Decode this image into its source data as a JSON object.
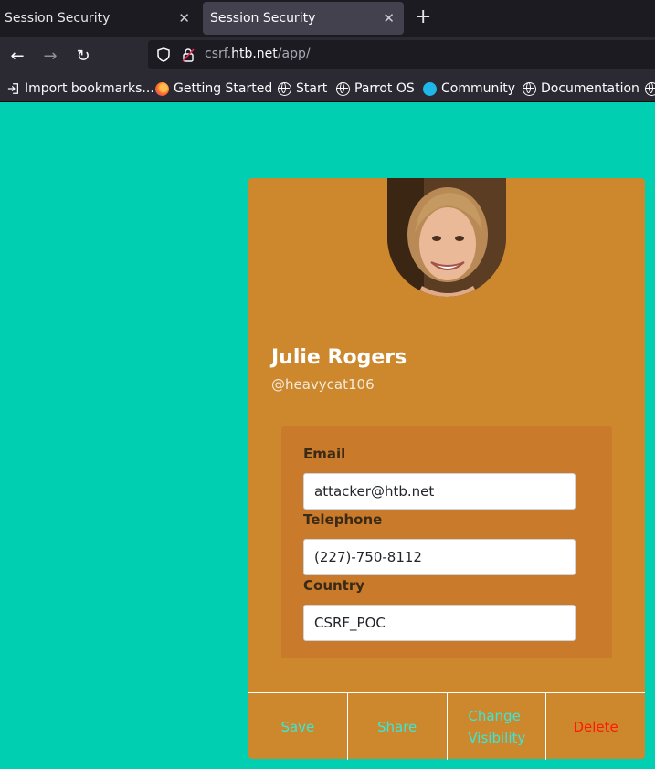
{
  "browser": {
    "tabs": [
      {
        "title": "Session Security",
        "active": false
      },
      {
        "title": "Session Security",
        "active": true
      }
    ],
    "url": {
      "sub": "csrf.",
      "domain": "htb.net",
      "path": "/app/"
    },
    "bookmarks": [
      {
        "label": "Import bookmarks...",
        "icon": "import-icon"
      },
      {
        "label": "Getting Started",
        "icon": "firefox-icon"
      },
      {
        "label": "Start",
        "icon": "globe-icon"
      },
      {
        "label": "Parrot OS",
        "icon": "globe-icon"
      },
      {
        "label": "Community",
        "icon": "parrot-icon"
      },
      {
        "label": "Documentation",
        "icon": "globe-icon"
      }
    ]
  },
  "profile": {
    "name": "Julie Rogers",
    "handle": "@heavycat106",
    "fields": {
      "email": {
        "label": "Email",
        "value": "attacker@htb.net"
      },
      "telephone": {
        "label": "Telephone",
        "value": "(227)-750-8112"
      },
      "country": {
        "label": "Country",
        "value": "CSRF_POC"
      }
    },
    "actions": {
      "save": "Save",
      "share": "Share",
      "visibility": "Change Visibility",
      "delete": "Delete"
    }
  },
  "colors": {
    "page_bg": "#00d0b1",
    "card_bg": "#cd882e",
    "panel_bg": "#c97a2b",
    "action_link": "#39e7d8",
    "delete_link": "#ff1a00"
  }
}
